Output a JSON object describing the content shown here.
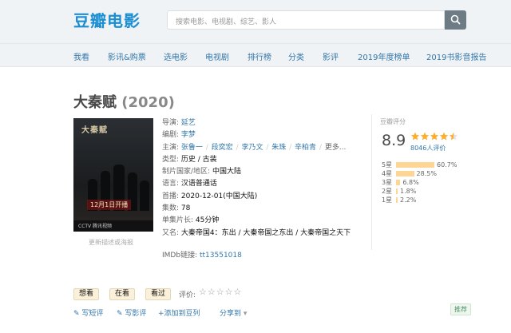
{
  "header": {
    "logo": "豆瓣电影",
    "search_placeholder": "搜索电影、电视剧、综艺、影人"
  },
  "nav": [
    "我看",
    "影讯&购票",
    "选电影",
    "电视剧",
    "排行榜",
    "分类",
    "影评",
    "2019年度榜单",
    "2019书影音报告"
  ],
  "movie": {
    "title": "大秦赋",
    "year": "(2020)",
    "poster_title": "大秦赋",
    "poster_date": "12月1日开播",
    "poster_brand": "CCTV 腾讯视频",
    "poster_link": "更新描述或海报",
    "director_label": "导演:",
    "director": "延艺",
    "writer_label": "编剧:",
    "writer": "李梦",
    "cast_label": "主演:",
    "cast": [
      "张鲁一",
      "段奕宏",
      "李乃文",
      "朱珠",
      "辛柏青"
    ],
    "cast_more": "更多...",
    "genre_label": "类型:",
    "genre": "历史 / 古装",
    "country_label": "制片国家/地区:",
    "country": "中国大陆",
    "language_label": "语言:",
    "language": "汉语普通话",
    "premiere_label": "首播:",
    "premiere": "2020-12-01(中国大陆)",
    "episodes_label": "集数:",
    "episodes": "78",
    "runtime_label": "单集片长:",
    "runtime": "45分钟",
    "aka_label": "又名:",
    "aka": "大秦帝国4：东出 / 大秦帝国之东出 / 大秦帝国之天下",
    "imdb_label": "IMDb链接:",
    "imdb": "tt13551018"
  },
  "rating": {
    "label": "豆瓣评分",
    "score": "8.9",
    "stars_value": 4.5,
    "count": "8046人评价",
    "bars": [
      {
        "label": "5星",
        "pct": "60.7%",
        "value": 60.7
      },
      {
        "label": "4星",
        "pct": "28.5%",
        "value": 28.5
      },
      {
        "label": "3星",
        "pct": "6.8%",
        "value": 6.8
      },
      {
        "label": "2星",
        "pct": "1.8%",
        "value": 1.8
      },
      {
        "label": "1星",
        "pct": "2.2%",
        "value": 2.2
      }
    ],
    "bar_color": "#ffd596",
    "star_color": "#ffac2d"
  },
  "controls": {
    "want": "想看",
    "watching": "在看",
    "watched": "看过",
    "rate_label": "评价:",
    "rate_stars": "☆☆☆☆☆"
  },
  "actions": {
    "short_review": "写短评",
    "review": "写影评",
    "add_doulist": "+添加到豆列",
    "share": "分享到",
    "recommend": "推荐"
  },
  "colors": {
    "link": "#3377aa",
    "brand": "#1b8fd1"
  }
}
